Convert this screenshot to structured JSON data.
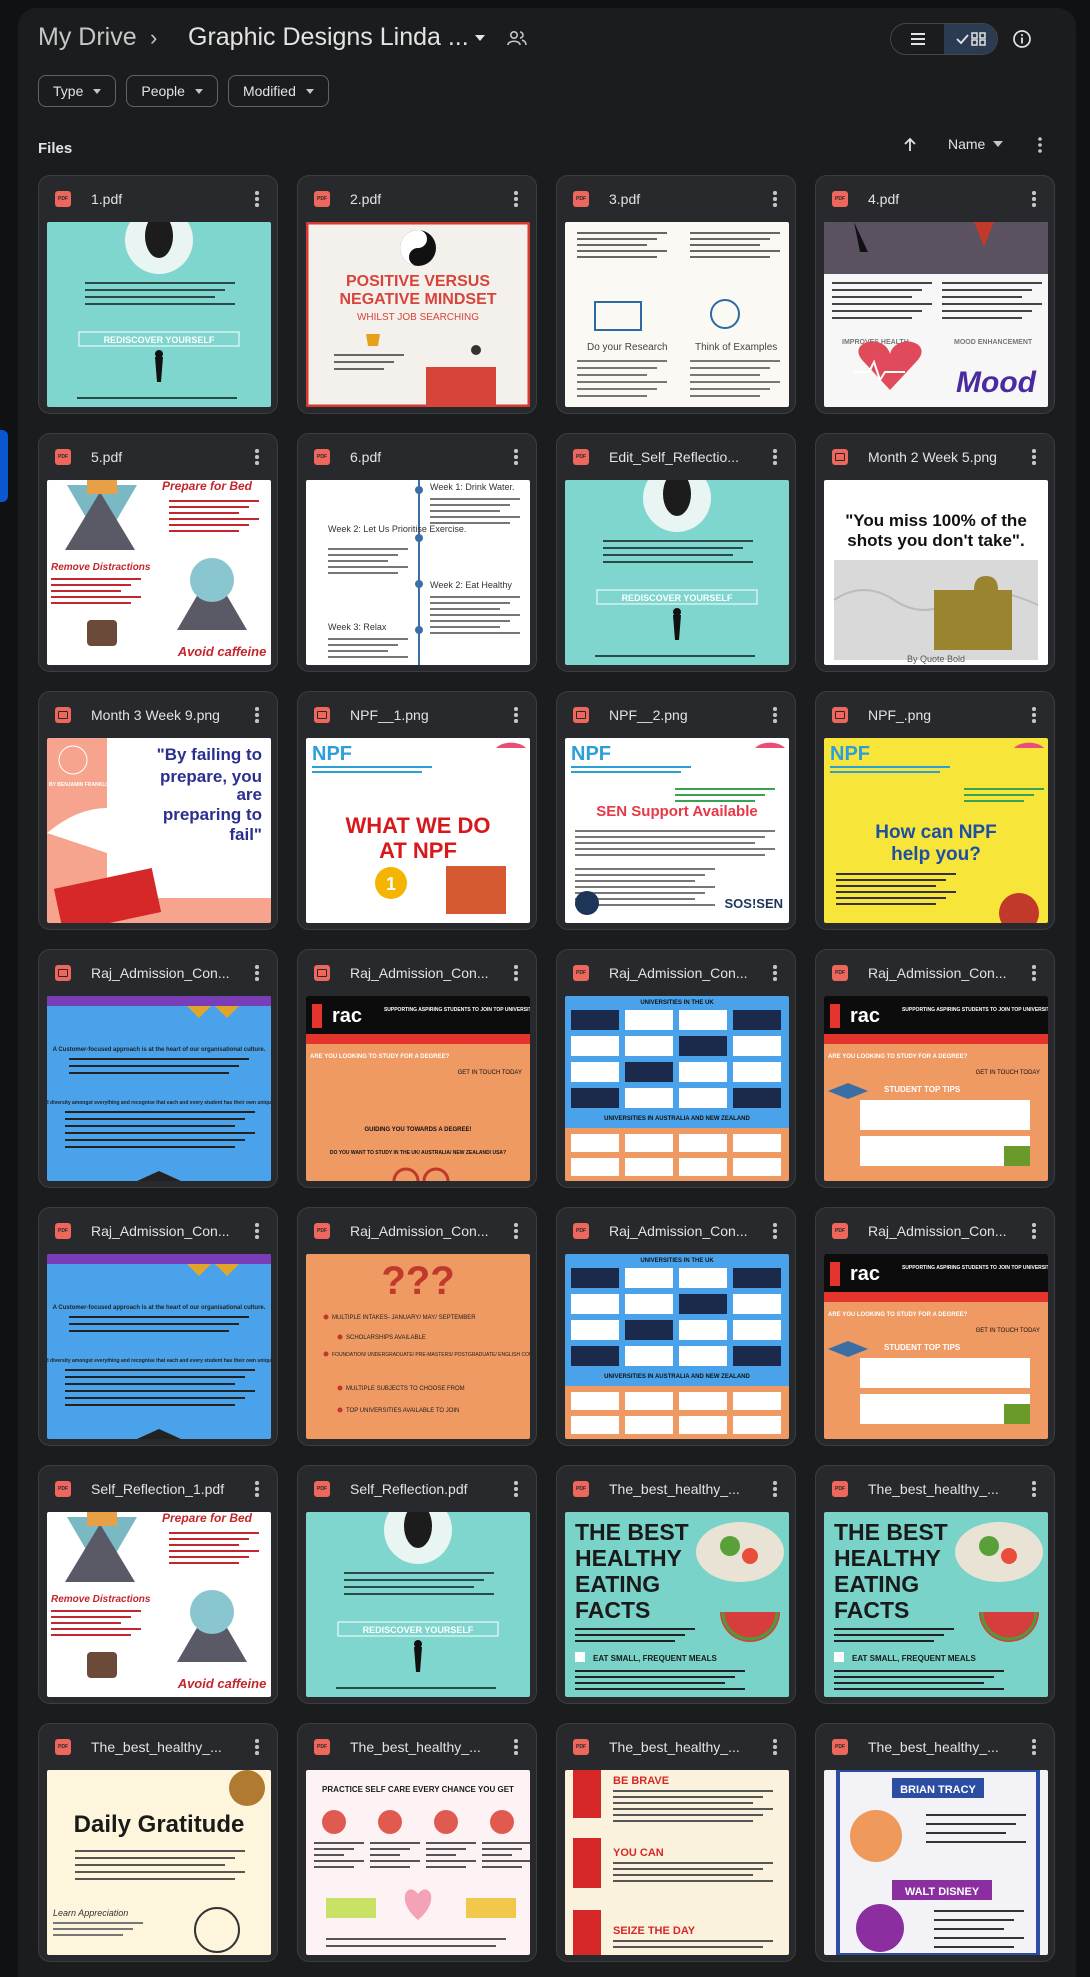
{
  "breadcrumb": {
    "root": "My Drive",
    "separator": "›",
    "current": "Graphic Designs Linda ..."
  },
  "filters": [
    "Type",
    "People",
    "Modified"
  ],
  "section": {
    "label": "Files"
  },
  "sort": {
    "label": "Name"
  },
  "colors": {
    "accent": "#0b57d0",
    "file_icon": "#ee675c",
    "selected_view": "#2b3b52"
  },
  "files": [
    {
      "name": "1.pdf",
      "type": "pdf",
      "thumb": "teal-reflection"
    },
    {
      "name": "2.pdf",
      "type": "pdf",
      "thumb": "mindset"
    },
    {
      "name": "3.pdf",
      "type": "pdf",
      "thumb": "research"
    },
    {
      "name": "4.pdf",
      "type": "pdf",
      "thumb": "mood"
    },
    {
      "name": "5.pdf",
      "type": "pdf",
      "thumb": "bed"
    },
    {
      "name": "6.pdf",
      "type": "pdf",
      "thumb": "weeks"
    },
    {
      "name": "Edit_Self_Reflectio...",
      "type": "pdf",
      "thumb": "teal-reflection"
    },
    {
      "name": "Month 2 Week 5.png",
      "type": "image",
      "thumb": "puzzle"
    },
    {
      "name": "Month 3 Week 9.png",
      "type": "image",
      "thumb": "failing"
    },
    {
      "name": "NPF__1.png",
      "type": "image",
      "thumb": "npf-what"
    },
    {
      "name": "NPF__2.png",
      "type": "image",
      "thumb": "npf-sen"
    },
    {
      "name": "NPF_.png",
      "type": "image",
      "thumb": "npf-help"
    },
    {
      "name": "Raj_Admission_Con...",
      "type": "image",
      "thumb": "raj-blue"
    },
    {
      "name": "Raj_Admission_Con...",
      "type": "image",
      "thumb": "raj-orange"
    },
    {
      "name": "Raj_Admission_Con...",
      "type": "pdf",
      "thumb": "raj-unis"
    },
    {
      "name": "Raj_Admission_Con...",
      "type": "pdf",
      "thumb": "raj-tips"
    },
    {
      "name": "Raj_Admission_Con...",
      "type": "pdf",
      "thumb": "raj-blue"
    },
    {
      "name": "Raj_Admission_Con...",
      "type": "pdf",
      "thumb": "raj-intakes"
    },
    {
      "name": "Raj_Admission_Con...",
      "type": "pdf",
      "thumb": "raj-unis"
    },
    {
      "name": "Raj_Admission_Con...",
      "type": "pdf",
      "thumb": "raj-tips"
    },
    {
      "name": "Self_Reflection_1.pdf",
      "type": "pdf",
      "thumb": "bed"
    },
    {
      "name": "Self_Reflection.pdf",
      "type": "pdf",
      "thumb": "teal-reflection"
    },
    {
      "name": "The_best_healthy_...",
      "type": "pdf",
      "thumb": "healthy"
    },
    {
      "name": "The_best_healthy_...",
      "type": "pdf",
      "thumb": "healthy"
    },
    {
      "name": "The_best_healthy_...",
      "type": "pdf",
      "thumb": "gratitude"
    },
    {
      "name": "The_best_healthy_...",
      "type": "pdf",
      "thumb": "selfcare"
    },
    {
      "name": "The_best_healthy_...",
      "type": "pdf",
      "thumb": "brave"
    },
    {
      "name": "The_best_healthy_...",
      "type": "pdf",
      "thumb": "tracy"
    }
  ],
  "thumb_text": {
    "rediscover": "REDISCOVER YOURSELF",
    "positive": "POSITIVE VERSUS",
    "negative": "NEGATIVE MINDSET",
    "whilst": "WHILST JOB SEARCHING",
    "research": "Do your Research",
    "examples": "Think of Examples",
    "improves": "IMPROVES HEALTH",
    "mood_enh": "MOOD ENHANCEMENT",
    "mood": "Mood",
    "prepare": "Prepare for Bed",
    "remove": "Remove Distractions",
    "caffeine": "Avoid caffeine",
    "week1": "Week 1: Drink Water.",
    "week2": "Week 2: Let Us Prioritise Exercise.",
    "week2b": "Week 2: Eat Healthy",
    "week3": "Week 3: Relax",
    "quote1": "\"You miss 100% of the",
    "quote2": "shots you don't take\".",
    "quote_by": "By Quote Bold",
    "benjamin": "BY BENJAMIN FRANKLIN",
    "failing1": "\"By failing to",
    "failing2": "prepare, you",
    "failing3": "are",
    "failing4": "preparing to",
    "failing5": "fail\"",
    "npf_logo": "NPF",
    "npf_tag": "Newham Parent Forum Supporting Parents of 0-25 Year Olds",
    "what_we_do1": "WHAT WE DO",
    "what_we_do2": "AT NPF",
    "sen_support": "SEN Support Available",
    "sos": "SOS!SEN",
    "npf_help1": "How can NPF",
    "npf_help2": "help you?",
    "rac": "rac",
    "raj_banner": "SUPPORTING ASPIRING STUDENTS TO JOIN TOP UNIVERSITIES GLOBALLY",
    "raj_q": "ARE YOU LOOKING TO STUDY FOR A DEGREE?",
    "raj_touch": "GET IN TOUCH TODAY",
    "raj_guide": "GUIDING YOU TOWARDS A DEGREE!",
    "raj_study": "DO YOU WANT TO STUDY IN THE UK/ AUSTRALIA/ NEW ZEALAND/ USA?",
    "raj_tips": "STUDENT TOP TIPS",
    "raj_customer": "A Customer-focused approach is at the heart of our organisational culture.",
    "raj_diversity": "We recognise differences and diversity amongst everything and recognise that each and every student has their own unique strengths and weaknesses.",
    "raj_aus": "UNIVERSITIES IN AUSTRALIA AND NEW ZEALAND",
    "raj_uk": "UNIVERSITIES IN THE UK",
    "raj_intakes": "MULTIPLE INTAKES- JANUARY/ MAY/ SEPTEMBER",
    "raj_scholar": "SCHOLARSHIPS AVAILABLE",
    "raj_foundation": "FOUNDATION/ UNDERGRADUATE/ PRE-MASTERS/ POSTGRADUATE/ ENGLISH COURSES",
    "raj_subjects": "MULTIPLE SUBJECTS TO CHOOSE FROM",
    "raj_top": "TOP UNIVERSITIES AVAILABLE TO JOIN",
    "healthy1": "THE BEST",
    "healthy2": "HEALTHY",
    "healthy3": "EATING",
    "healthy4": "FACTS",
    "eat_small": "EAT SMALL, FREQUENT MEALS",
    "gratitude": "Daily Gratitude",
    "learn": "Learn Appreciation",
    "selfcare": "PRACTICE SELF CARE EVERY CHANCE YOU GET",
    "be_brave": "BE BRAVE",
    "you_can": "YOU CAN",
    "seize": "SEIZE THE DAY",
    "tracy": "BRIAN TRACY",
    "tracy_quote": "Make your life a masterpiece; imagine no limitations on what you can be, have, or do.",
    "disney": "WALT DISNEY",
    "disney_quote": "All our dreams can come true if we have the courage to pursue them."
  }
}
